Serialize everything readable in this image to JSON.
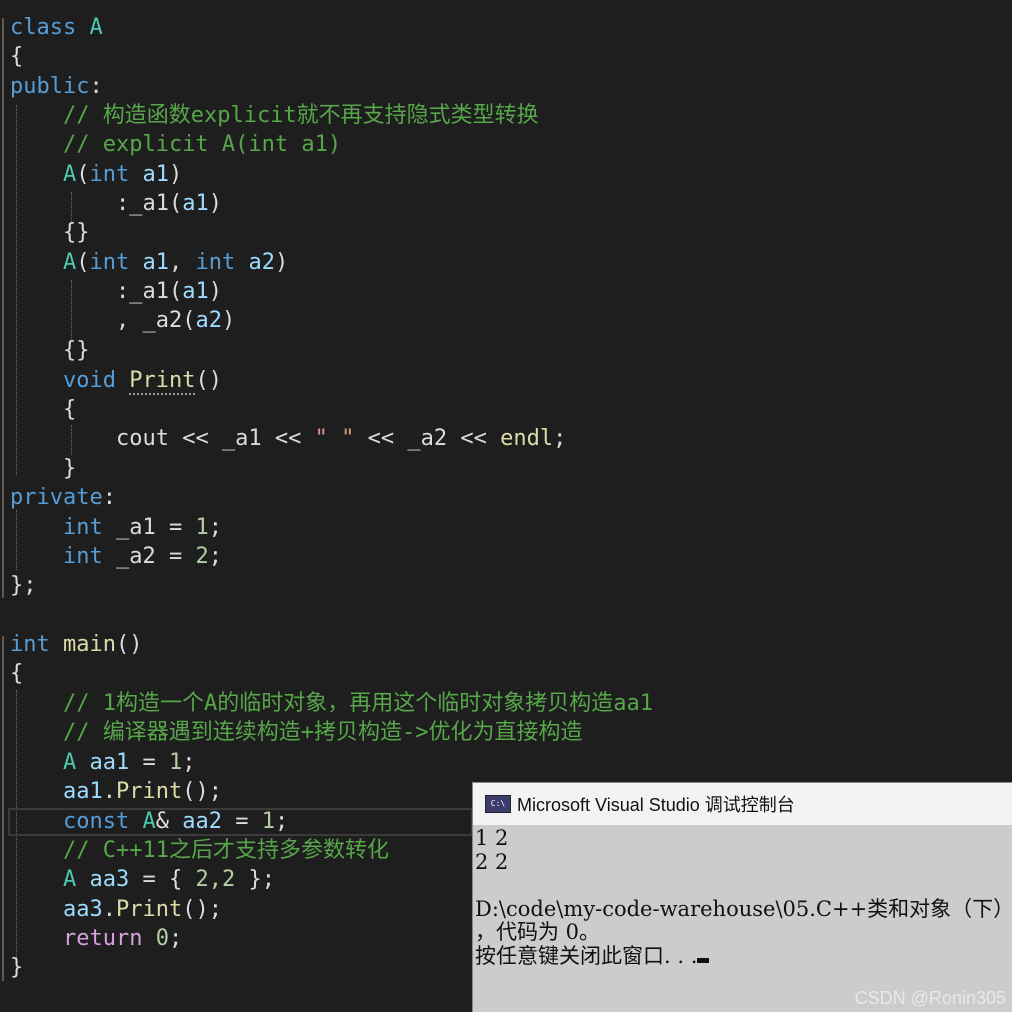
{
  "code": {
    "class_kw": "class",
    "class_name": "A",
    "open_brace": "{",
    "close_brace_semi": "};",
    "close_brace": "}",
    "public_kw": "public",
    "private_kw": "private",
    "colon": ":",
    "comment_explicit_1": "// 构造函数explicit就不再支持隐式类型转换",
    "comment_explicit_2": "// explicit A(int a1)",
    "int_kw": "int",
    "void_kw": "void",
    "const_kw": "const",
    "return_kw": "return",
    "ctor_name": "A",
    "param_a1": "a1",
    "param_a2": "a2",
    "init_a1": ":_a1",
    "init_a2_prefix": ", _a2",
    "member_a1": "_a1",
    "member_a2": "_a2",
    "empty_body": "{}",
    "print_fn": "Print",
    "cout": "cout",
    "endl": "endl",
    "space_str": "\" \"",
    "main_fn": "main",
    "comment_main_1": "// 1构造一个A的临时对象，再用这个临时对象拷贝构造aa1",
    "comment_main_2": "// 编译器遇到连续构造+拷贝构造->优化为直接构造",
    "comment_main_3": "// C++11之后才支持多参数转化",
    "var_aa1": "aa1",
    "var_aa2": "aa2",
    "var_aa3": "aa3",
    "num_0": "0",
    "num_1": "1",
    "num_2": "2",
    "init_list": "2,2"
  },
  "console": {
    "title": "Microsoft Visual Studio 调试控制台",
    "icon_label": "C:\\",
    "lines": [
      "1 2",
      "2 2",
      "",
      "D:\\code\\my-code-warehouse\\05.C++类和对象（下）",
      "，代码为 0。",
      "按任意键关闭此窗口. . ."
    ]
  },
  "watermark": "CSDN @Ronin305"
}
